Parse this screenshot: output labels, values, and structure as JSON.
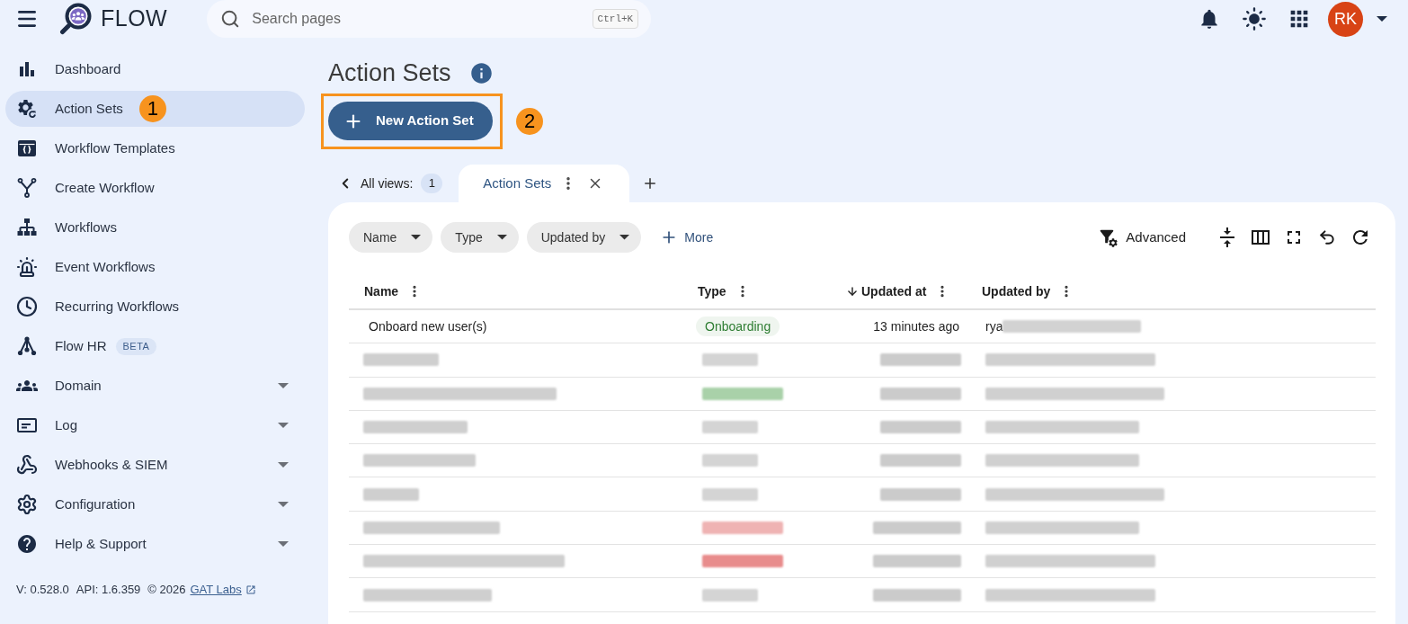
{
  "topbar": {
    "app_name": "FLOW",
    "search": {
      "placeholder": "Search pages",
      "shortcut": "Ctrl+K"
    },
    "avatar": {
      "initials": "RK"
    }
  },
  "sidebar": {
    "items": [
      {
        "label": "Dashboard",
        "kind": "link",
        "selected": false
      },
      {
        "label": "Action Sets",
        "kind": "link",
        "selected": true,
        "marker": "1"
      },
      {
        "label": "Workflow Templates",
        "kind": "link",
        "selected": false
      },
      {
        "label": "Create Workflow",
        "kind": "link",
        "selected": false
      },
      {
        "label": "Workflows",
        "kind": "link",
        "selected": false
      },
      {
        "label": "Event Workflows",
        "kind": "link",
        "selected": false
      },
      {
        "label": "Recurring Workflows",
        "kind": "link",
        "selected": false
      },
      {
        "label": "Flow HR",
        "kind": "link",
        "selected": false,
        "badge": "BETA"
      },
      {
        "label": "Domain",
        "kind": "group",
        "selected": false
      },
      {
        "label": "Log",
        "kind": "group",
        "selected": false
      },
      {
        "label": "Webhooks & SIEM",
        "kind": "group",
        "selected": false
      },
      {
        "label": "Configuration",
        "kind": "group",
        "selected": false
      },
      {
        "label": "Help & Support",
        "kind": "group",
        "selected": false
      }
    ],
    "footer": {
      "version": "V: 0.528.0",
      "api": "API: 1.6.359",
      "copyright": "© 2026",
      "link": "GAT Labs"
    }
  },
  "main": {
    "title": "Action Sets",
    "primary_button": {
      "label": "New Action Set",
      "highlighted": true,
      "marker": "2"
    },
    "views": {
      "label": "All views:",
      "count": "1",
      "tabs": [
        {
          "label": "Action Sets",
          "selected": true
        }
      ]
    },
    "filters": [
      "Name",
      "Type",
      "Updated by"
    ],
    "more": "More",
    "advanced": "Advanced",
    "table": {
      "columns": [
        {
          "label": "Name",
          "sorted": false
        },
        {
          "label": "Type",
          "sorted": false
        },
        {
          "label": "Updated at",
          "sorted": true
        },
        {
          "label": "Updated by",
          "sorted": false
        }
      ],
      "rows": [
        {
          "kind": "text",
          "name": "Onboard new user(s)",
          "type": {
            "label": "Onboarding",
            "color": "#2e7d32"
          },
          "updated_at": "13 minutes ago",
          "updated_by": {
            "text": "rya",
            "redacted": true
          }
        },
        {
          "kind": "redacted",
          "type": {
            "color": "#d4d4d4"
          }
        },
        {
          "kind": "redacted",
          "type": {
            "color": "#a9d1a9"
          }
        },
        {
          "kind": "redacted",
          "type": {
            "color": "#d4d4d4"
          }
        },
        {
          "kind": "redacted",
          "type": {
            "color": "#d4d4d4"
          }
        },
        {
          "kind": "redacted",
          "type": {
            "color": "#d4d4d4"
          }
        },
        {
          "kind": "redacted",
          "type": {
            "color": "#efb3b3"
          }
        },
        {
          "kind": "redacted",
          "type": {
            "color": "#e88c8c"
          }
        },
        {
          "kind": "redacted",
          "type": {
            "color": "#d4d4d4"
          }
        }
      ]
    }
  }
}
